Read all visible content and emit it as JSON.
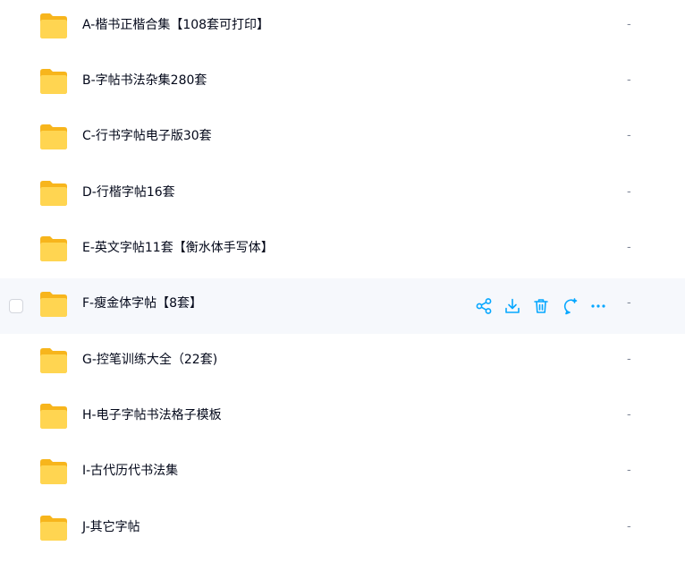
{
  "files": [
    {
      "name": "A-楷书正楷合集【108套可打印】",
      "meta": "-"
    },
    {
      "name": "B-字帖书法杂集280套",
      "meta": "-"
    },
    {
      "name": "C-行书字帖电子版30套",
      "meta": "-"
    },
    {
      "name": "D-行楷字帖16套",
      "meta": "-"
    },
    {
      "name": "E-英文字帖11套【衡水体手写体】",
      "meta": "-"
    },
    {
      "name": "F-瘦金体字帖【8套】",
      "meta": "-"
    },
    {
      "name": "G-控笔训练大全（22套)",
      "meta": "-"
    },
    {
      "name": "H-电子字帖书法格子模板",
      "meta": "-"
    },
    {
      "name": "I-古代历代书法集",
      "meta": "-"
    },
    {
      "name": "J-其它字帖",
      "meta": "-"
    }
  ],
  "hovered_row_index": 5,
  "row_actions": [
    "share-icon",
    "download-icon",
    "delete-icon",
    "comment-icon",
    "more-icon"
  ],
  "colors": {
    "accent": "#06a7ff",
    "folder_back": "#f7b51c",
    "folder_front": "#ffd551",
    "hover_bg": "#f6f8fc",
    "text": "#03081a",
    "meta_text": "#818999"
  }
}
